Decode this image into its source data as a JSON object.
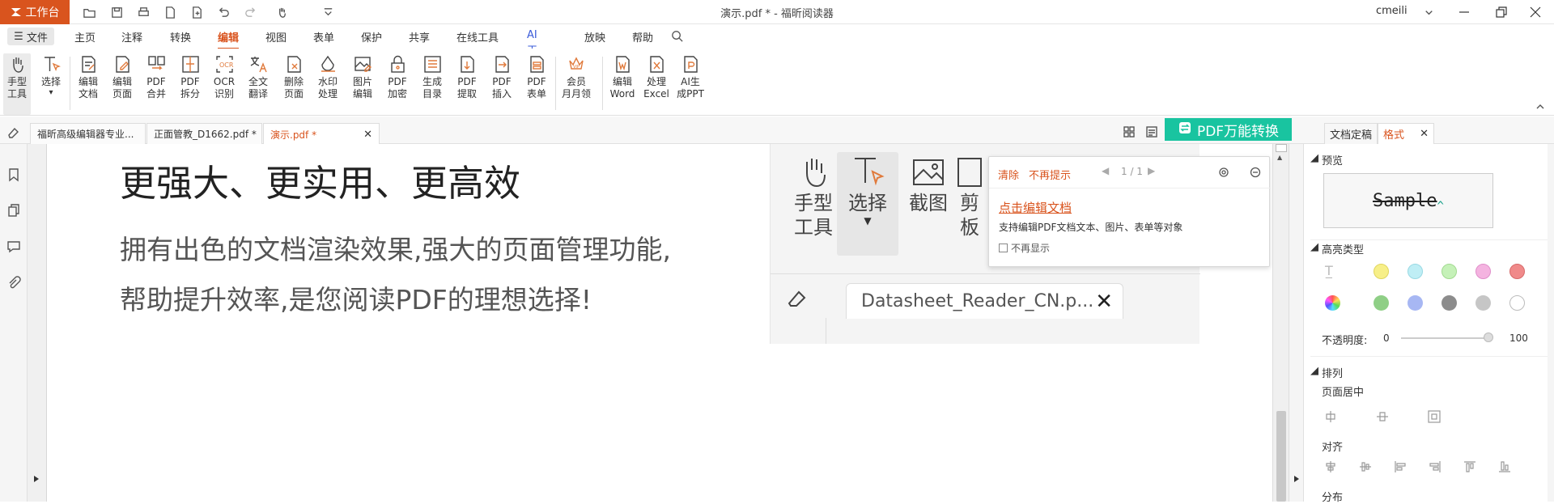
{
  "titlebar": {
    "workbench": "工作台",
    "doc_title": "演示.pdf * - 福昕阅读器",
    "user": "cmeili"
  },
  "menubar": {
    "file": "文件",
    "tabs": [
      "主页",
      "注释",
      "转换",
      "编辑",
      "视图",
      "表单",
      "保护",
      "共享",
      "在线工具",
      "AI工具",
      "放映",
      "帮助"
    ],
    "active_tab": "编辑"
  },
  "ribbon": {
    "buttons": [
      {
        "label": "手型\n工具",
        "icon": "hand-icon"
      },
      {
        "label": "选择",
        "icon": "select-text-icon"
      },
      {
        "label": "编辑\n文档",
        "icon": "edit-doc-icon"
      },
      {
        "label": "编辑\n页面",
        "icon": "edit-page-icon"
      },
      {
        "label": "PDF\n合并",
        "icon": "merge-icon"
      },
      {
        "label": "PDF\n拆分",
        "icon": "split-icon"
      },
      {
        "label": "OCR\n识别",
        "icon": "ocr-icon"
      },
      {
        "label": "全文\n翻译",
        "icon": "translate-icon"
      },
      {
        "label": "删除\n页面",
        "icon": "delete-page-icon"
      },
      {
        "label": "水印\n处理",
        "icon": "watermark-icon"
      },
      {
        "label": "图片\n编辑",
        "icon": "image-edit-icon"
      },
      {
        "label": "PDF\n加密",
        "icon": "encrypt-icon"
      },
      {
        "label": "生成\n目录",
        "icon": "toc-icon"
      },
      {
        "label": "PDF\n提取",
        "icon": "extract-icon"
      },
      {
        "label": "PDF\n插入",
        "icon": "insert-icon"
      },
      {
        "label": "PDF\n表单",
        "icon": "form-icon"
      },
      {
        "label": "会员\n月月领",
        "icon": "vip-icon"
      },
      {
        "label": "编辑\nWord",
        "icon": "word-icon"
      },
      {
        "label": "处理\nExcel",
        "icon": "excel-icon"
      },
      {
        "label": "AI生\n成PPT",
        "icon": "ppt-icon"
      }
    ]
  },
  "tabs": {
    "docs": [
      {
        "label": "福昕高级编辑器专业...",
        "active": false
      },
      {
        "label": "正面管教_D1662.pdf *",
        "active": false
      },
      {
        "label": "演示.pdf *",
        "active": true
      }
    ],
    "pdf_convert": "PDF万能转换",
    "right_tabs": [
      "文档定稿",
      "格式"
    ]
  },
  "document": {
    "heading": "更强大、更实用、更高效",
    "body_line1": "拥有出色的文档渲染效果,强大的页面管理功能,",
    "body_line2": "帮助提升效率,是您阅读PDF的理想选择!"
  },
  "screenshot": {
    "tools": [
      "手型\n工具",
      "选择",
      "截图",
      "剪\n板"
    ],
    "tab_label": "Datasheet_Reader_CN.p..."
  },
  "popup": {
    "clear": "清除",
    "no_remind": "不再提示",
    "pager": "1 / 1",
    "title": "点击编辑文档",
    "desc": "支持编辑PDF文档文本、图片、表单等对象",
    "checkbox": "不再显示"
  },
  "format_panel": {
    "preview_label": "预览",
    "sample": "Sample",
    "highlight_label": "高亮类型",
    "highlight_colors": [
      "#f7ef88",
      "#bfeef5",
      "#c5f1b8",
      "#f4b3e0",
      "#f08a8a",
      "#gradient",
      "#8fcf86",
      "#a7b7f3",
      "#8c8c8c",
      "#c6c6c6",
      "#ffffff"
    ],
    "opacity_label": "不透明度:",
    "opacity_min": "0",
    "opacity_max": "100",
    "opacity_value": 1.0,
    "arrange_label": "排列",
    "page_center_label": "页面居中",
    "align_label": "对齐",
    "distribute_label": "分布"
  }
}
